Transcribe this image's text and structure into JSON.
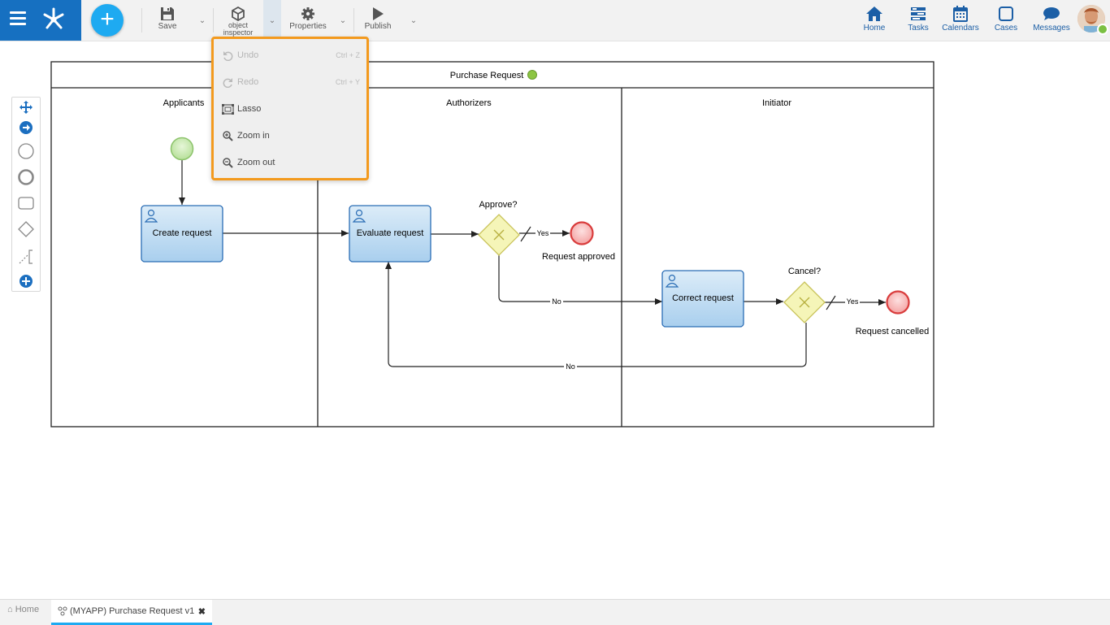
{
  "toolbar": {
    "save_label": "Save",
    "object_inspector_label": "object inspector",
    "properties_label": "Properties",
    "publish_label": "Publish"
  },
  "nav": {
    "home": "Home",
    "tasks": "Tasks",
    "calendars": "Calendars",
    "cases": "Cases",
    "messages": "Messages"
  },
  "menu": {
    "items": [
      {
        "label": "Undo",
        "shortcut": "Ctrl + Z",
        "disabled": true,
        "icon": "undo-icon"
      },
      {
        "label": "Redo",
        "shortcut": "Ctrl + Y",
        "disabled": true,
        "icon": "redo-icon"
      },
      {
        "label": "Lasso",
        "shortcut": "",
        "disabled": false,
        "icon": "lasso-icon"
      },
      {
        "label": "Zoom in",
        "shortcut": "",
        "disabled": false,
        "icon": "zoom-in-icon"
      },
      {
        "label": "Zoom out",
        "shortcut": "",
        "disabled": false,
        "icon": "zoom-out-icon"
      }
    ]
  },
  "diagram": {
    "pool_title": "Purchase Request",
    "lanes": [
      "Applicants",
      "Authorizers",
      "Initiator"
    ],
    "tasks": [
      "Create request",
      "Evaluate request",
      "Correct request"
    ],
    "gateways": [
      "Approve?",
      "Cancel?"
    ],
    "end_events": [
      "Request approved",
      "Request cancelled"
    ],
    "flow_labels": {
      "yes1": "Yes",
      "no1": "No",
      "yes2": "Yes",
      "no2": "No"
    }
  },
  "bottom": {
    "home_tab": "Home",
    "active_tab": "(MYAPP) Purchase Request v1"
  },
  "colors": {
    "brand": "#1670c1",
    "accent": "#1eaaf1",
    "highlight": "#f39a1e",
    "task_fill": "#c7dff2",
    "start_event": "#c9eab0",
    "end_event": "#f7b9b9",
    "gateway": "#f5f5b8"
  }
}
